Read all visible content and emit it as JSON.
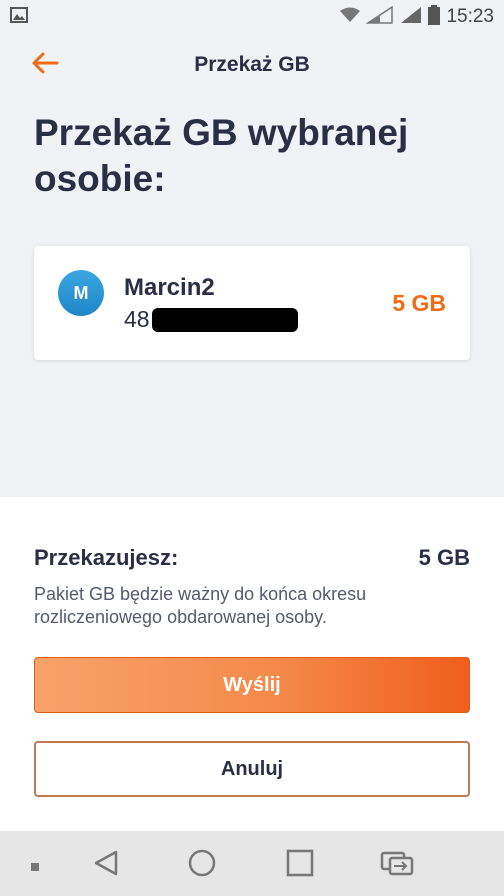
{
  "status_bar": {
    "time": "15:23",
    "icons": [
      "image-icon",
      "wifi-icon",
      "signal-icon",
      "signal-icon",
      "battery-icon"
    ]
  },
  "app_bar": {
    "title": "Przekaż GB",
    "back_icon": "arrow-left-icon"
  },
  "page": {
    "heading": "Przekaż GB wybranej osobie:"
  },
  "recipient": {
    "avatar_letter": "M",
    "name": "Marcin2",
    "number_prefix": "48",
    "amount": "5 GB"
  },
  "summary": {
    "label": "Przekazujesz:",
    "value": "5 GB",
    "note": "Pakiet GB będzie ważny do końca okresu rozliczeniowego obdarowanej osoby."
  },
  "buttons": {
    "send": "Wyślij",
    "cancel": "Anuluj"
  },
  "colors": {
    "accent": "#f06b16",
    "background": "#f1f2f6",
    "text_primary": "#2a2f45",
    "avatar": "#2a96d6"
  },
  "nav_bar": {
    "items": [
      "dot-icon",
      "back-triangle-icon",
      "home-circle-icon",
      "recents-square-icon",
      "switch-sim-icon"
    ]
  }
}
